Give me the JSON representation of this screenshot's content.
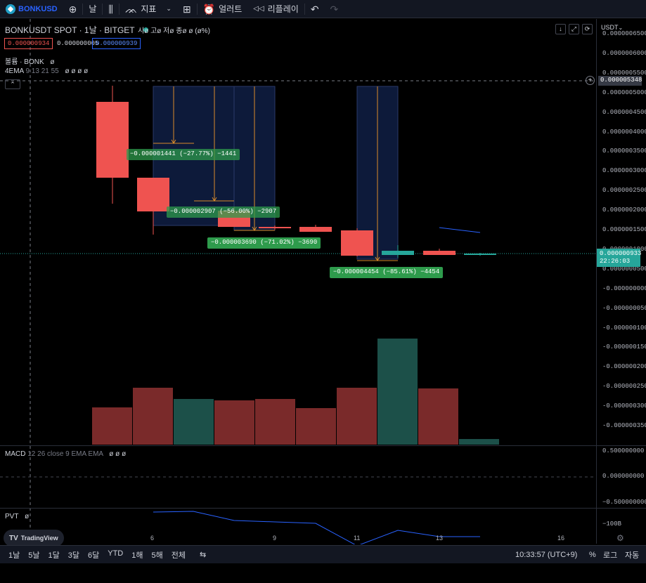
{
  "toolbar": {
    "symbol": "BONKUSD",
    "interval": "날",
    "indicators": "지표",
    "alert": "얼러트",
    "replay": "리플레이"
  },
  "legend": {
    "title": "BONKUSDT SPOT · 1날 · BITGET",
    "ohlc": "시ø 고ø 저ø 종ø ø (ø%)",
    "bid": "0.000000934",
    "spread": "0.000000005",
    "ask": "0.000000939",
    "volume": "볼륨 · BONK",
    "volume_value": "ø",
    "ema": "4EMA",
    "ema_params": "9 13 21 55",
    "ema_values": "ø ø ø ø"
  },
  "price_axis": {
    "currency": "USDT",
    "labels": [
      "0.0000006500",
      "0.0000006000",
      "0.0000005500",
      "0.0000005000",
      "0.0000004500",
      "0.0000004000",
      "0.0000003500",
      "0.0000003000",
      "0.0000002500",
      "0.0000002000",
      "0.0000001500",
      "0.0000001000",
      "0.0000000500",
      "-0.0000000000",
      "-0.0000000500",
      "-0.0000001000",
      "-0.0000001500",
      "-0.0000002000",
      "-0.0000002500",
      "-0.0000003000",
      "-0.0000003500"
    ],
    "crosshair_price": "0.000005348",
    "current_price": "0.000000933",
    "countdown": "22:26:03"
  },
  "measures": [
    {
      "text": "−0.000001441 (−27.77%) −1441"
    },
    {
      "text": "−0.000002907 (−56.00%) −2907"
    },
    {
      "text": "−0.000003690 (−71.02%) −3690"
    },
    {
      "text": "−0.000004454 (−85.61%) −4454"
    }
  ],
  "macd": {
    "name": "MACD",
    "params": "12 26 close 9 EMA EMA",
    "values": "ø ø ø",
    "axis": [
      "0.500000000",
      "0.000000000",
      "−0.500000000"
    ]
  },
  "pvt": {
    "name": "PVT",
    "value": "ø",
    "axis": "−100B"
  },
  "time_axis": [
    "6",
    "9",
    "11",
    "13",
    "16"
  ],
  "bottom": {
    "ranges": [
      "1날",
      "5날",
      "1달",
      "3달",
      "6달",
      "YTD",
      "1해",
      "5해",
      "전체"
    ],
    "clock": "10:33:57 (UTC+9)",
    "percent": "%",
    "log": "로그",
    "auto": "자동"
  },
  "branding": "TradingView",
  "colors": {
    "up": "#26a69a",
    "down": "#ef5350",
    "vol_up": "#1c5049",
    "vol_down": "#7a2a2a",
    "measure": "#2e9b4c",
    "range_bg": "#0d1a3a",
    "pvt_line": "#2962ff"
  }
}
